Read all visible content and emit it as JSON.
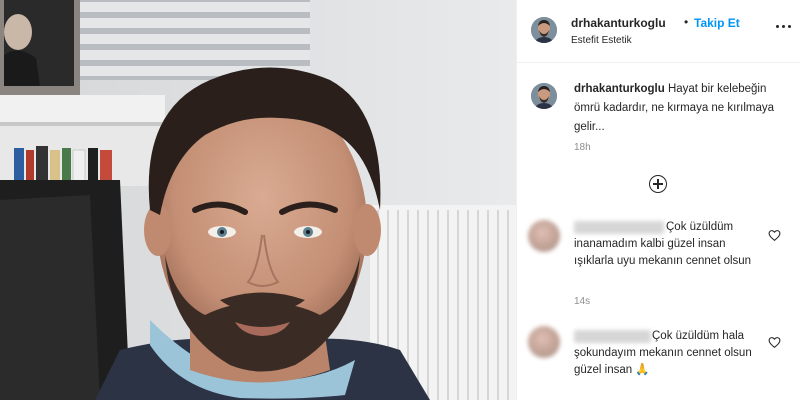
{
  "post": {
    "header": {
      "username": "drhakanturkoglu",
      "separator": "•",
      "follow_label": "Takip Et",
      "subtitle": "Estefit Estetik",
      "more_icon": "more-horizontal-icon"
    },
    "caption": {
      "username": "drhakanturkoglu",
      "text": "Hayat bir kelebeğin ömrü kadardır, ne kırmaya ne kırılmaya gelir...",
      "time": "18h"
    },
    "load_more_icon": "plus-circle-icon",
    "comments": [
      {
        "text": "Çok üzüldüm inanamadım kalbi güzel insan ışıklarla uyu mekanın cennet olsun",
        "time": "14s",
        "like_icon": "heart-icon"
      },
      {
        "text": "Çok üzüldüm hala şokundayım mekanın cennet olsun güzel insan 🙏",
        "like_icon": "heart-icon"
      }
    ]
  },
  "colors": {
    "link": "#0095f6",
    "text": "#262626",
    "muted": "#8e8e8e",
    "divider": "#efefef"
  }
}
